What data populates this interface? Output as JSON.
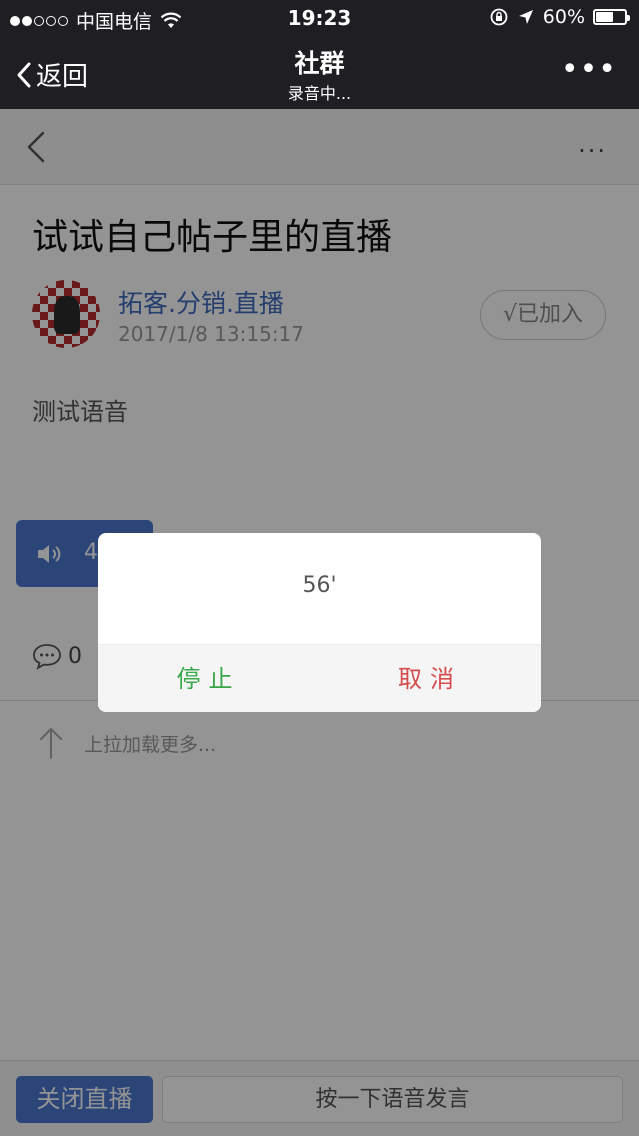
{
  "status_bar": {
    "carrier": "中国电信",
    "time": "19:23",
    "battery_percent": "60%",
    "battery_level": 0.6,
    "signal_bars": 2
  },
  "nav": {
    "back_label": "返回",
    "title": "社群",
    "subtitle": "录音中..."
  },
  "post": {
    "title": "试试自己帖子里的直播",
    "author": "拓客.分销.直播",
    "time": "2017/1/8 13:15:17",
    "join_label": "√已加入",
    "body": "测试语音",
    "voice_duration": "4",
    "comment_count": "0",
    "load_more": "上拉加载更多..."
  },
  "bottom_bar": {
    "close_live_label": "关闭直播",
    "voice_input_label": "按一下语音发言"
  },
  "dialog": {
    "count": "56'",
    "stop_label": "停止",
    "cancel_label": "取消"
  },
  "colors": {
    "accent_blue": "#4a77d0",
    "stop_green": "#3aa64a",
    "cancel_red": "#d64c4c"
  },
  "icons": [
    "wifi-icon",
    "rotation-lock-icon",
    "location-arrow-icon",
    "speaker-icon",
    "comment-icon",
    "arrow-up-icon"
  ]
}
